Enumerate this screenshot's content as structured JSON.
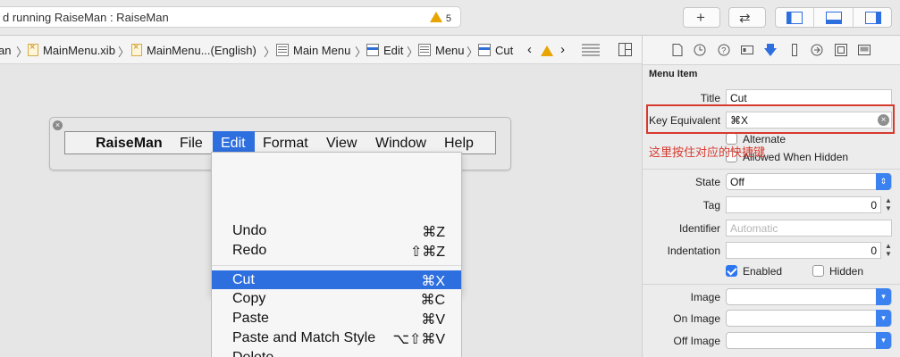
{
  "toolbar": {
    "activity_text": "d running RaiseMan : RaiseMan",
    "warning_count": "5",
    "add_button": "+",
    "flip_button": "⇄"
  },
  "jumpbar": {
    "items": [
      "an",
      "MainMenu.xib",
      "MainMenu...(English)",
      "Main Menu",
      "Edit",
      "Menu",
      "Cut"
    ]
  },
  "menubar": {
    "items": [
      "RaiseMan",
      "File",
      "Edit",
      "Format",
      "View",
      "Window",
      "Help"
    ]
  },
  "dropdown": {
    "items": [
      {
        "label": "Undo",
        "key": "⌘Z"
      },
      {
        "label": "Redo",
        "key": "⇧⌘Z"
      },
      {
        "label": "Cut",
        "key": "⌘X"
      },
      {
        "label": "Copy",
        "key": "⌘C"
      },
      {
        "label": "Paste",
        "key": "⌘V"
      },
      {
        "label": "Paste and Match Style",
        "key": "⌥⇧⌘V"
      },
      {
        "label": "Delete",
        "key": ""
      }
    ]
  },
  "inspector": {
    "section": "Menu Item",
    "title_label": "Title",
    "title_value": "Cut",
    "key_label": "Key Equivalent",
    "key_value": "⌘X",
    "alternate": "Alternate",
    "allowed_hidden": "Allowed When Hidden",
    "annotation": "这里按住对应的快捷键",
    "state_label": "State",
    "state_value": "Off",
    "tag_label": "Tag",
    "tag_value": "0",
    "identifier_label": "Identifier",
    "identifier_placeholder": "Automatic",
    "indentation_label": "Indentation",
    "indentation_value": "0",
    "enabled": "Enabled",
    "hidden": "Hidden",
    "image_label": "Image",
    "on_image_label": "On Image",
    "off_image_label": "Off Image"
  }
}
